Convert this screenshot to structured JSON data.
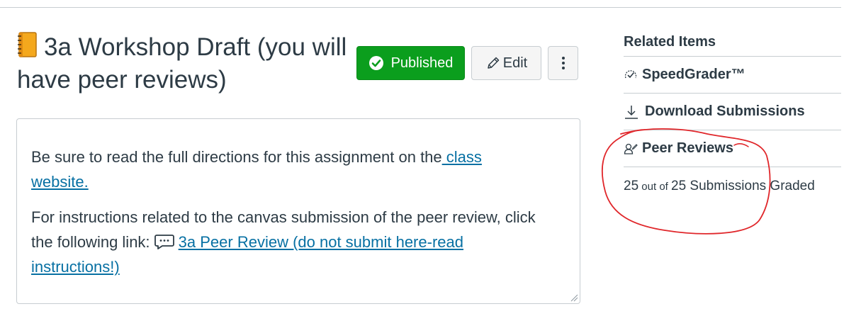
{
  "header": {
    "title": "3a Workshop Draft (you will have peer reviews)",
    "notebook_icon": "notebook-icon"
  },
  "toolbar": {
    "published_label": "Published",
    "edit_label": "Edit",
    "more_label": "⋮"
  },
  "description": {
    "para1_text": "Be sure to read the full directions for this assignment on the",
    "para1_link": " class website.",
    "para2_text": "For instructions related to the canvas submission of the peer review, click the following link: ",
    "para2_link": "3a Peer Review (do not submit here-read instructions!)"
  },
  "sidebar": {
    "heading": "Related Items",
    "items": [
      {
        "label": "SpeedGrader™",
        "icon": "speedgrader-icon"
      },
      {
        "label": "Download Submissions",
        "icon": "download-icon"
      },
      {
        "label": "Peer Reviews",
        "icon": "peer-reviews-icon"
      }
    ],
    "graded_count": "25",
    "graded_mid": " out of ",
    "graded_total": "25",
    "graded_suffix": " Submissions Graded"
  },
  "colors": {
    "published": "#0b9e1d",
    "link": "#0770a3",
    "annotation": "#e0262a"
  }
}
